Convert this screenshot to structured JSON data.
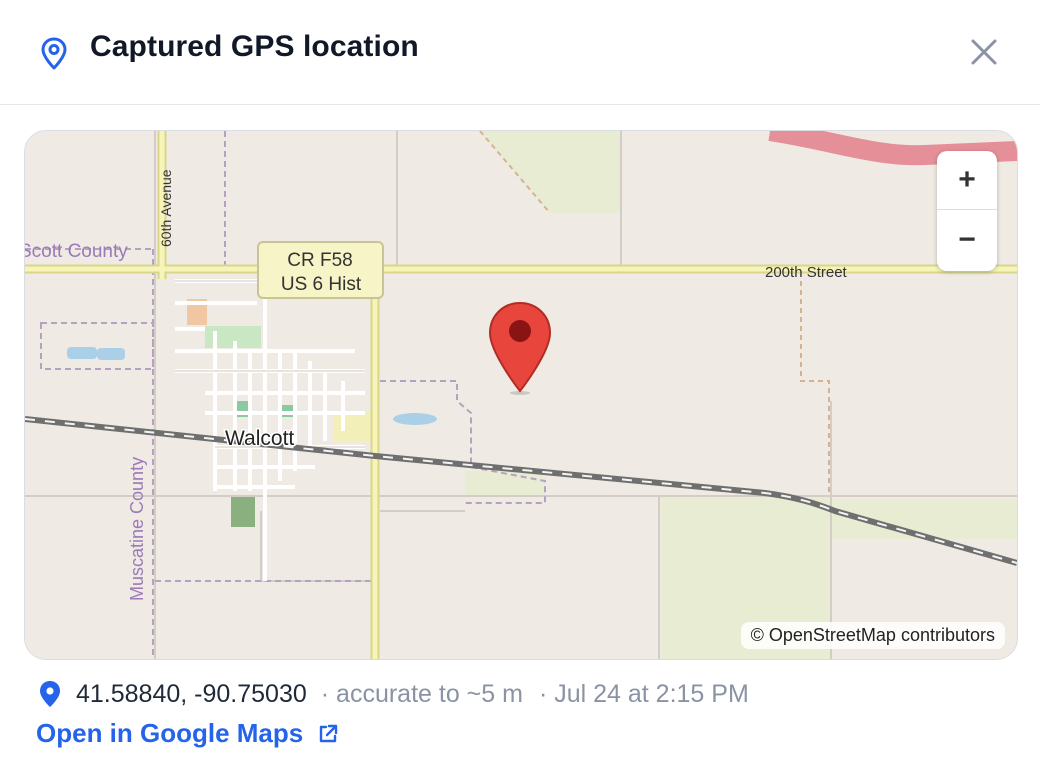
{
  "dialog": {
    "title": "Captured GPS location",
    "title_icon": "map-pin-icon",
    "close_icon": "close-icon"
  },
  "map": {
    "labels": {
      "scott_county": "Scott County",
      "avenue_60th": "60th Avenue",
      "route_shield_line1": "CR F58",
      "route_shield_line2": "US 6 Hist",
      "street_200th": "200th Street",
      "town": "Walcott",
      "muscatine_county": "Muscatine County"
    },
    "zoom_in": "+",
    "zoom_out": "−",
    "attribution": "© OpenStreetMap contributors",
    "marker_color": "#e8453c"
  },
  "location": {
    "pin_icon": "location-pin-icon",
    "coordinates": "41.58840, -90.75030",
    "accuracy": "· accurate to ~5 m",
    "timestamp": "· Jul 24 at 2:15 PM"
  },
  "link": {
    "label": "Open in Google Maps",
    "icon": "external-link-icon",
    "color": "#2563eb"
  }
}
